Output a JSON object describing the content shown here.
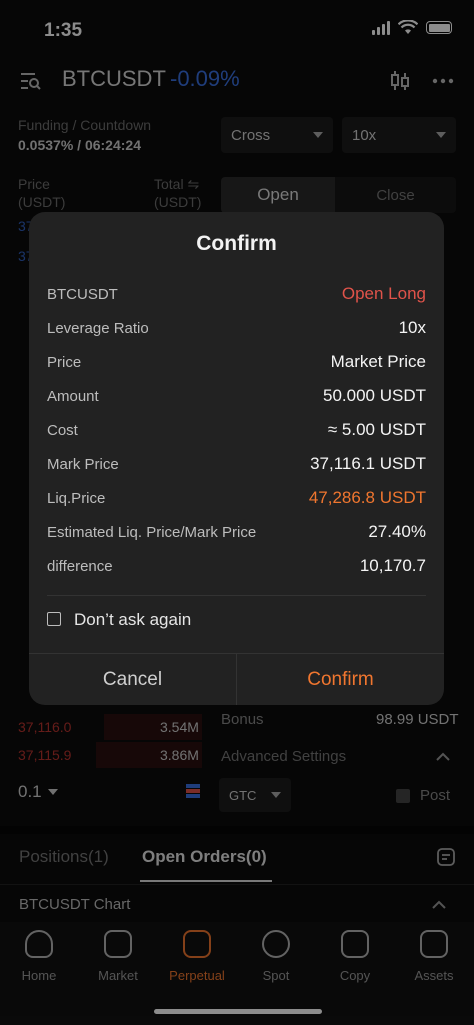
{
  "status_bar": {
    "time": "1:35"
  },
  "header": {
    "pair": "BTCUSDT",
    "change": "-0.09%"
  },
  "funding": {
    "label": "Funding / Countdown",
    "value": "0.0537% / 06:24:24"
  },
  "selects": {
    "margin_mode": "Cross",
    "leverage": "10x"
  },
  "orderbook": {
    "price_header": "Price\n(USDT)",
    "total_header": "Total ⇋\n(USDT)",
    "bottom_rows": [
      {
        "price": "37,116.0",
        "total": "3.54M"
      },
      {
        "price": "37,115.9",
        "total": "3.86M"
      }
    ],
    "precision": "0.1"
  },
  "trade_tabs": {
    "open": "Open",
    "close": "Close"
  },
  "bonus": {
    "label": "Bonus",
    "value": "98.99 USDT"
  },
  "advanced": {
    "label": "Advanced Settings"
  },
  "order_type": {
    "value": "GTC"
  },
  "post": {
    "label": "Post"
  },
  "bottom_tabs": {
    "positions": "Positions(1)",
    "open_orders": "Open Orders(0)"
  },
  "chart_section": {
    "label": "BTCUSDT Chart"
  },
  "modal": {
    "title": "Confirm",
    "rows": [
      {
        "key": "BTCUSDT",
        "value": "Open Long"
      },
      {
        "key": "Leverage Ratio",
        "value": "10x"
      },
      {
        "key": "Price",
        "value": "Market Price"
      },
      {
        "key": "Amount",
        "value": "50.000 USDT"
      },
      {
        "key": "Cost",
        "value": "≈ 5.00 USDT"
      },
      {
        "key": "Mark Price",
        "value": "37,116.1 USDT"
      },
      {
        "key": "Liq.Price",
        "value": "47,286.8 USDT"
      },
      {
        "key": "Estimated Liq. Price/Mark Price",
        "value": "27.40%"
      },
      {
        "key": "difference",
        "value": "10,170.7"
      }
    ],
    "dont_ask": "Don’t ask again",
    "cancel": "Cancel",
    "confirm": "Confirm"
  },
  "nav": [
    {
      "label": "Home",
      "icon": "home-icon"
    },
    {
      "label": "Market",
      "icon": "market-icon"
    },
    {
      "label": "Perpetual",
      "icon": "perpetual-icon"
    },
    {
      "label": "Spot",
      "icon": "spot-icon"
    },
    {
      "label": "Copy",
      "icon": "copy-icon"
    },
    {
      "label": "Assets",
      "icon": "assets-icon"
    }
  ],
  "colors": {
    "accent": "#f0762f",
    "negative_blue": "#3a6fe0",
    "sell_red": "#e0534a"
  }
}
